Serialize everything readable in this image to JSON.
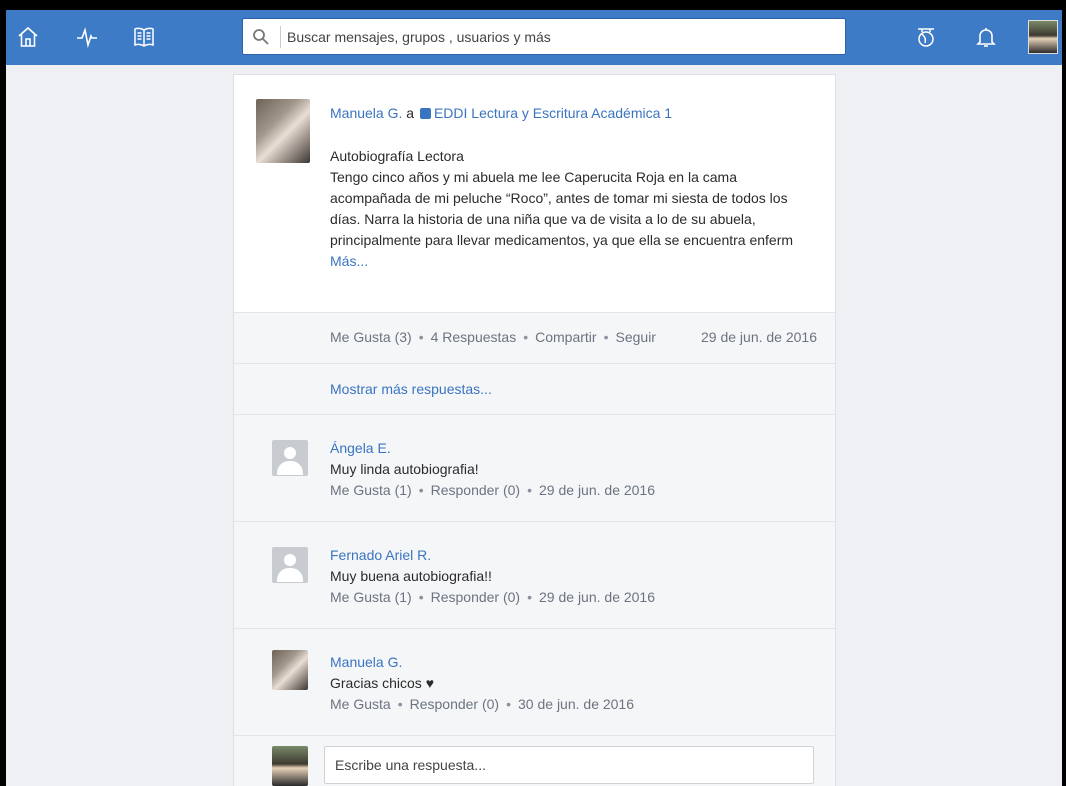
{
  "topbar": {
    "icons": [
      "home-icon",
      "activity-icon",
      "book-icon",
      "hand-icon",
      "bell-icon"
    ],
    "search": {
      "placeholder": "Buscar mensajes, grupos , usuarios y más",
      "value": ""
    }
  },
  "post": {
    "author": "Manuela G.",
    "connector": "a",
    "group": "EDDI Lectura y Escritura Académica 1",
    "title": "Autobiografía Lectora",
    "body": "Tengo cinco años y mi abuela me lee Caperucita Roja en la cama acompañada de mi peluche “Roco”, antes de tomar mi siesta de todos los días. Narra la historia de una niña que va de visita a lo de su abuela, principalmente para llevar medicamentos, ya que ella se encuentra enferm",
    "more_label": "Más...",
    "actions": {
      "like": "Me Gusta (3)",
      "replies": "4 Respuestas",
      "share": "Compartir",
      "follow": "Seguir",
      "date": "29 de jun. de 2016"
    }
  },
  "show_more_replies": "Mostrar más respuestas...",
  "replies": [
    {
      "author": "Ángela E.",
      "text": "Muy linda autobiografia!",
      "like": "Me Gusta (1)",
      "reply": "Responder (0)",
      "date": "29 de jun. de 2016",
      "avatar": "default-avatar-icon"
    },
    {
      "author": "Fernado Ariel R.",
      "text": "Muy buena autobiografia!!",
      "like": "Me Gusta (1)",
      "reply": "Responder (0)",
      "date": "29 de jun. de 2016",
      "avatar": "default-avatar-icon"
    },
    {
      "author": "Manuela G.",
      "text": "Gracias chicos ♥",
      "like": "Me Gusta",
      "reply": "Responder (0)",
      "date": "30 de jun. de 2016",
      "avatar": "photo"
    }
  ],
  "composer": {
    "placeholder": "Escribe una respuesta..."
  },
  "separator": "•",
  "colors": {
    "topbar": "#3e7bc7",
    "link": "#3a74c0",
    "page_bg": "#eef0f3",
    "meta_text": "#6b7480"
  }
}
